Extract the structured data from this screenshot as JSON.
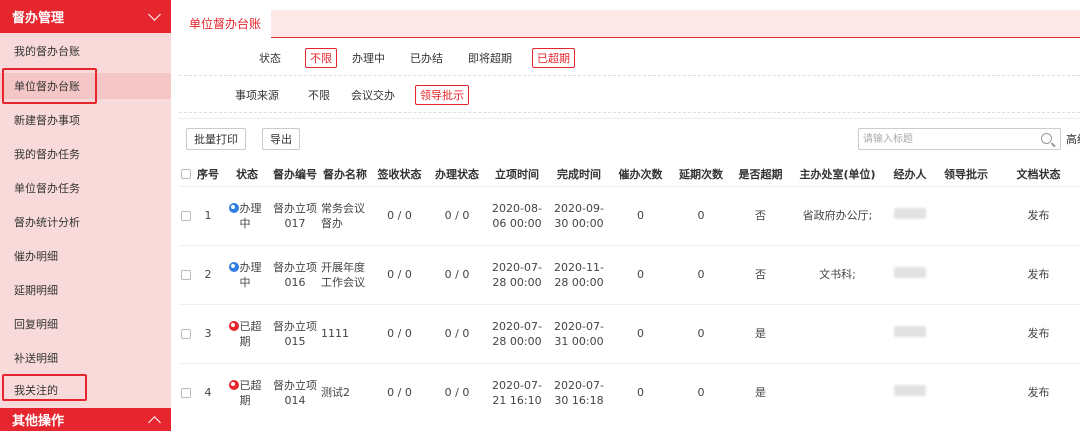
{
  "sidebar": {
    "header": "督办管理",
    "items": [
      "我的督办台账",
      "单位督办台账",
      "新建督办事项",
      "我的督办任务",
      "单位督办任务",
      "督办统计分析",
      "催办明细",
      "延期明细",
      "回复明细",
      "补送明细",
      "我关注的"
    ],
    "footer": "其他操作"
  },
  "tab": {
    "title": "单位督办台账"
  },
  "filters": {
    "status": {
      "label": "状态",
      "options": [
        "不限",
        "办理中",
        "已办结",
        "即将超期",
        "已超期"
      ]
    },
    "source": {
      "label": "事项来源",
      "options": [
        "不限",
        "会议交办",
        "领导批示"
      ]
    }
  },
  "toolbar": {
    "batch_print": "批量打印",
    "export": "导出",
    "search_placeholder": "请输入标题",
    "advanced": "高级"
  },
  "table": {
    "headers": [
      "序号",
      "状态",
      "督办编号",
      "督办名称",
      "签收状态",
      "办理状态",
      "立项时间",
      "完成时间",
      "催办次数",
      "延期次数",
      "是否超期",
      "主办处室(单位)",
      "经办人",
      "领导批示",
      "文档状态"
    ],
    "rows": [
      {
        "no": "1",
        "status": "办理中",
        "code": "督办立项017",
        "name": "常务会议督办",
        "sign": "0 / 0",
        "handle": "0 / 0",
        "start": "2020-08-06 00:00",
        "end": "2020-09-30 00:00",
        "urge": "0",
        "delay": "0",
        "overdue": "否",
        "dept": "省政府办公厅;",
        "doc": "发布"
      },
      {
        "no": "2",
        "status": "办理中",
        "code": "督办立项016",
        "name": "开展年度工作会议",
        "sign": "0 / 0",
        "handle": "0 / 0",
        "start": "2020-07-28 00:00",
        "end": "2020-11-28 00:00",
        "urge": "0",
        "delay": "0",
        "overdue": "否",
        "dept": "文书科;",
        "doc": "发布"
      },
      {
        "no": "3",
        "status": "已超期",
        "code": "督办立项015",
        "name": "1111",
        "sign": "0 / 0",
        "handle": "0 / 0",
        "start": "2020-07-28 00:00",
        "end": "2020-07-31 00:00",
        "urge": "0",
        "delay": "0",
        "overdue": "是",
        "dept": "",
        "doc": "发布"
      },
      {
        "no": "4",
        "status": "已超期",
        "code": "督办立项014",
        "name": "测试2",
        "sign": "0 / 0",
        "handle": "0 / 0",
        "start": "2020-07-21 16:10",
        "end": "2020-07-30 16:18",
        "urge": "0",
        "delay": "0",
        "overdue": "是",
        "dept": "",
        "doc": "发布"
      }
    ]
  },
  "colors": {
    "accent": "#e6262e",
    "sidebar_bg": "#f9dada",
    "in_progress": "#2f7de1",
    "overdue": "#e6262e"
  }
}
